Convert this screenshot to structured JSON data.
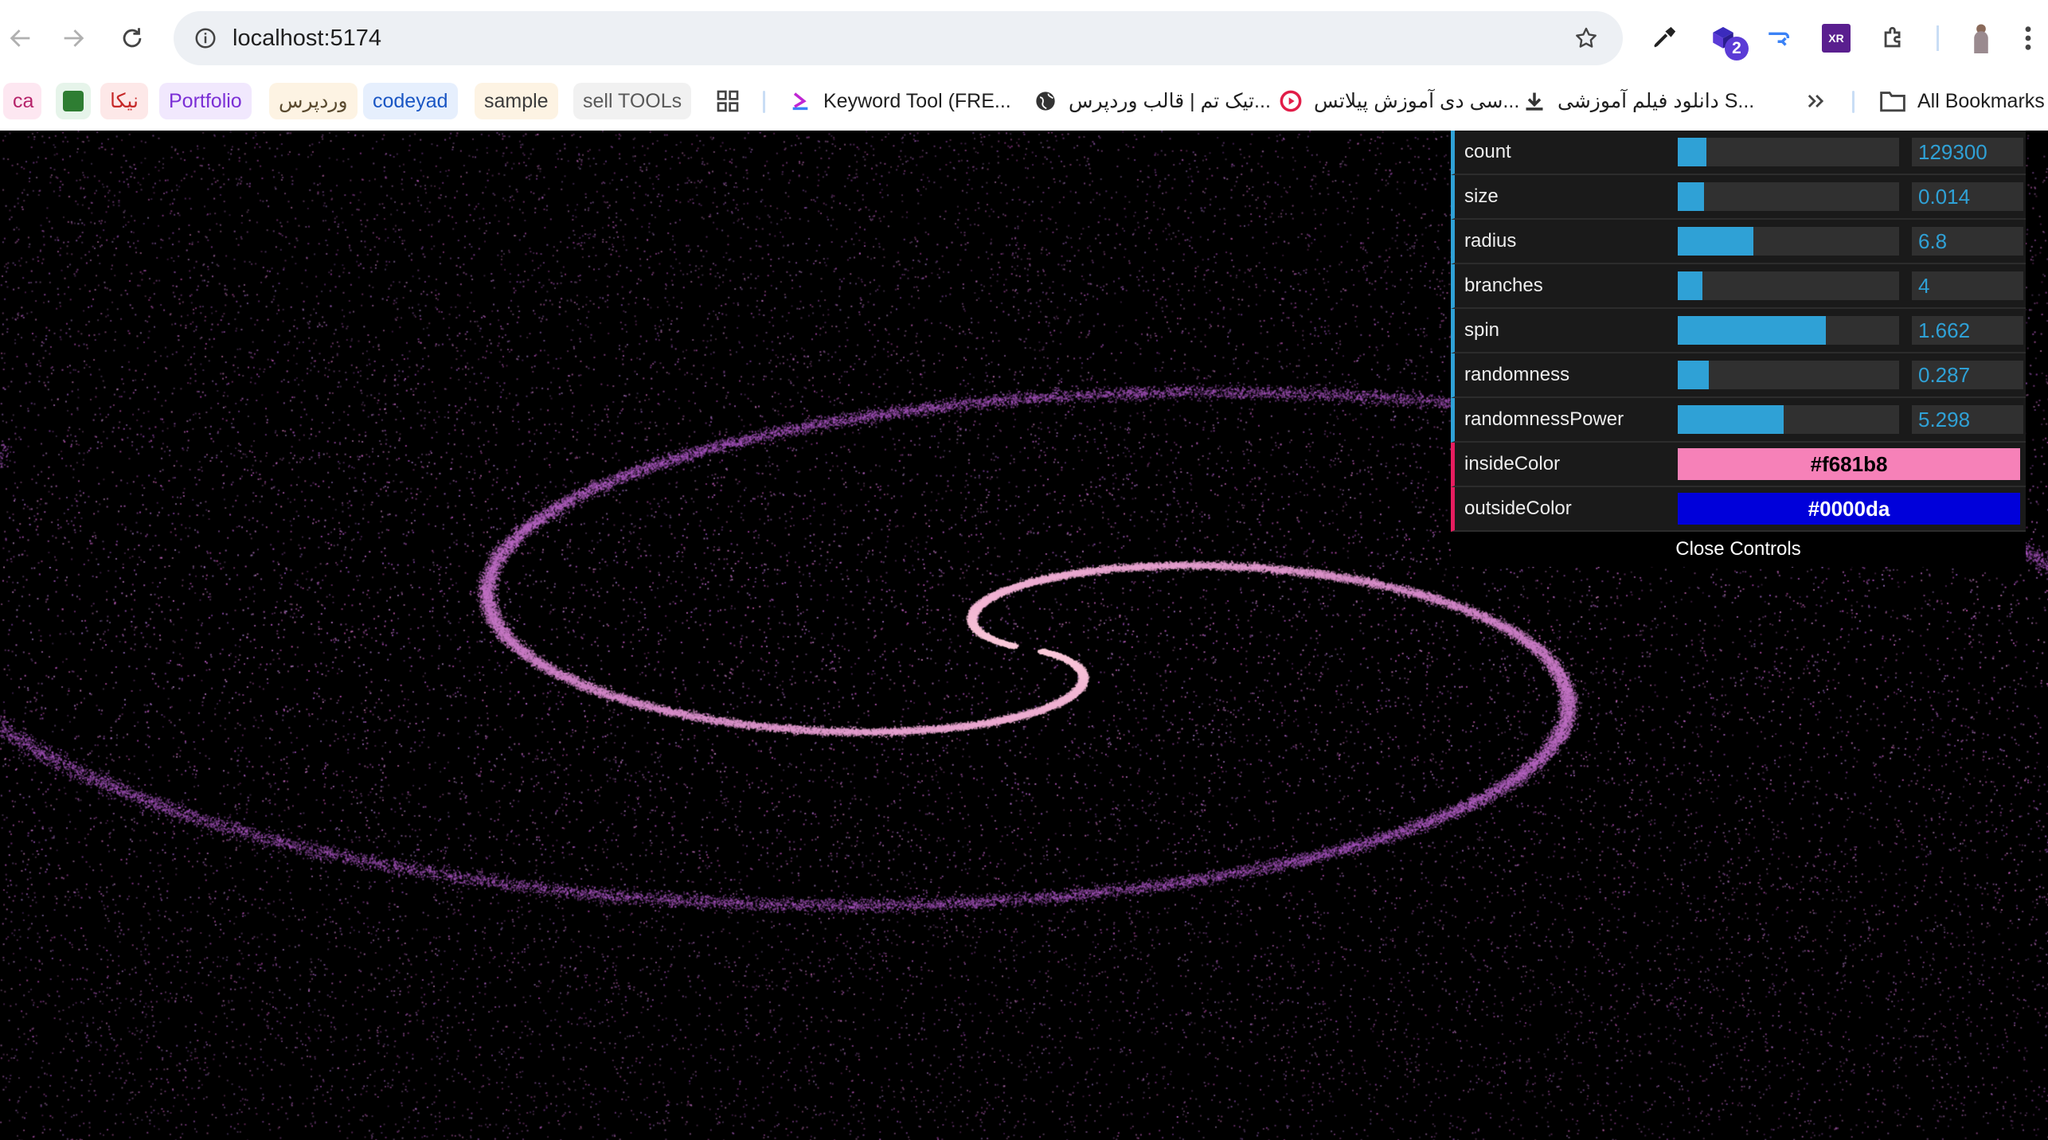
{
  "browser": {
    "url": "localhost:5174",
    "extension_badge": "2",
    "extension_xr_label": "XR"
  },
  "bookmarks": {
    "items": [
      {
        "label": "ca",
        "bg": "#fde7f1",
        "color": "#b5236a"
      },
      {
        "label": "",
        "bg": "#e6f4ea",
        "color": "#2e7d32"
      },
      {
        "label": "نیکا",
        "bg": "#fde8e8",
        "color": "#c62828"
      },
      {
        "label": "Portfolio",
        "bg": "#f1e8fd",
        "color": "#7b2fd6"
      },
      {
        "label": "وردپرس",
        "bg": "#fdf3e3",
        "color": "#5a4a2f"
      },
      {
        "label": "codeyad",
        "bg": "#e6effd",
        "color": "#1a56c4"
      },
      {
        "label": "sample",
        "bg": "#fdf3e3",
        "color": "#3b3b3b"
      },
      {
        "label": "sell TOOLs",
        "bg": "#f1f1f1",
        "color": "#5a5a5a"
      }
    ],
    "keyword_tool": "Keyword Tool (FRE...",
    "tik_tem": "تیک تم | قالب وردپرس...",
    "pilates": "سی دی آموزش پیلاتس...",
    "download_video": "دانلود فیلم آموزشی S...",
    "all_bookmarks": "All Bookmarks"
  },
  "controls": {
    "rows": [
      {
        "label": "count",
        "value": "129300",
        "fill": 0.13
      },
      {
        "label": "size",
        "value": "0.014",
        "fill": 0.12
      },
      {
        "label": "radius",
        "value": "6.8",
        "fill": 0.34
      },
      {
        "label": "branches",
        "value": "4",
        "fill": 0.11
      },
      {
        "label": "spin",
        "value": "1.662",
        "fill": 0.67
      },
      {
        "label": "randomness",
        "value": "0.287",
        "fill": 0.14
      },
      {
        "label": "randomnessPower",
        "value": "5.298",
        "fill": 0.48
      }
    ],
    "colors": [
      {
        "label": "insideColor",
        "value": "#f681b8",
        "text_color": "#000000"
      },
      {
        "label": "outsideColor",
        "value": "#0000da",
        "text_color": "#ffffff"
      }
    ],
    "close_label": "Close Controls"
  }
}
